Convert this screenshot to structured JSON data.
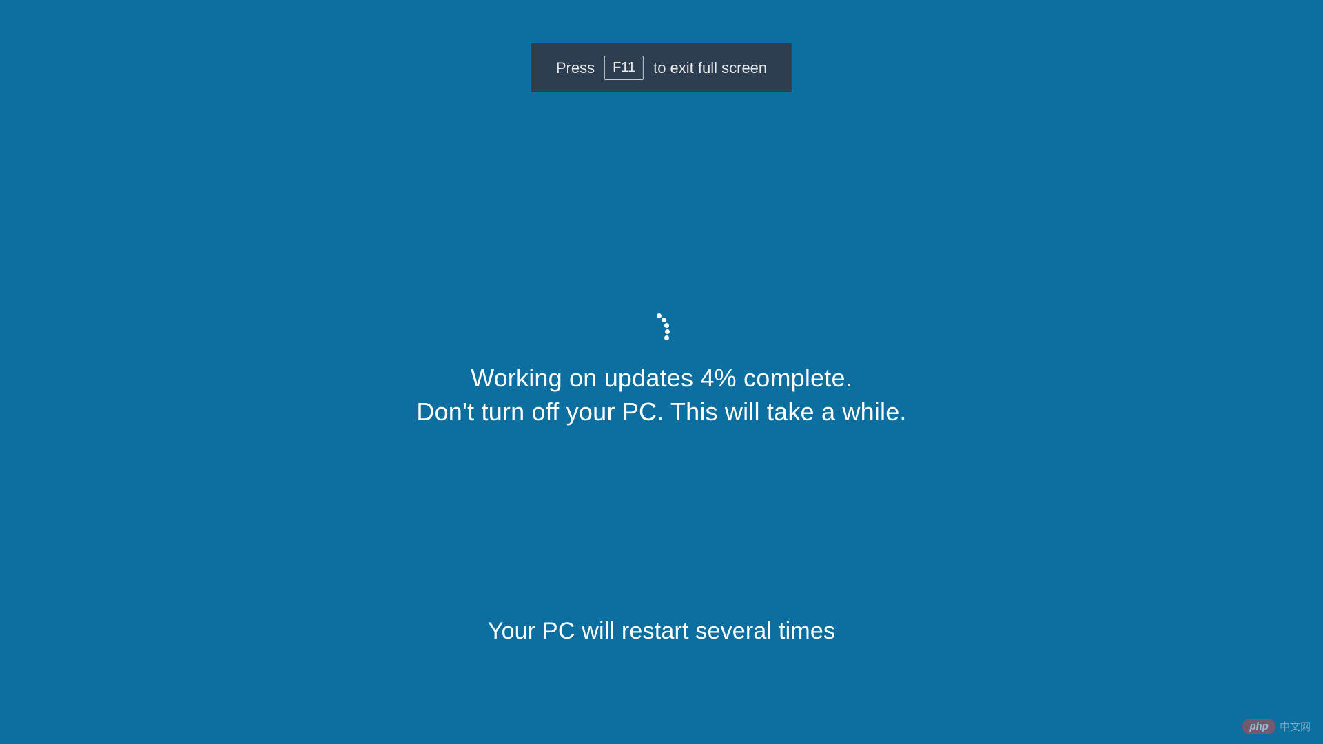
{
  "banner": {
    "press": "Press",
    "key": "F11",
    "exit": "to exit full screen"
  },
  "update": {
    "line1": "Working on updates  4% complete.",
    "line2": "Don't turn off your PC. This will take a while.",
    "restart": "Your PC will restart several times"
  },
  "watermark": {
    "logo": "php",
    "text": "中文网"
  },
  "colors": {
    "background": "#0d6ea0",
    "banner_bg": "#2c3e4f",
    "text": "#ffffff"
  }
}
